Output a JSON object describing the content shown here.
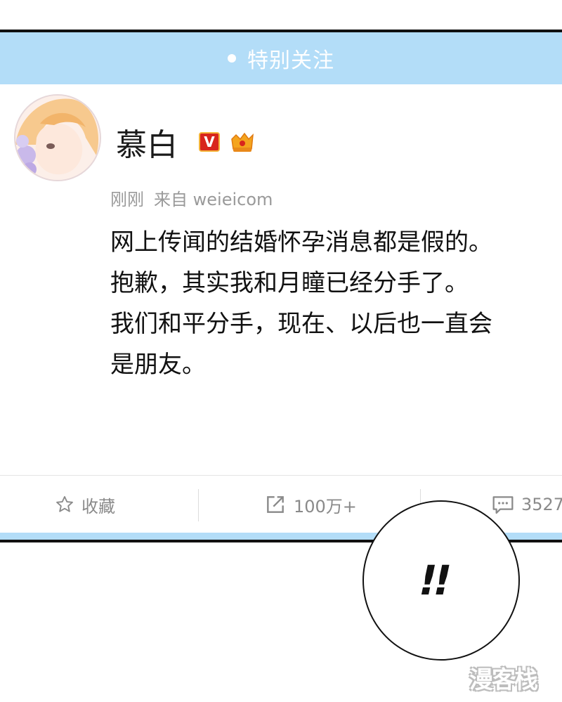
{
  "header": {
    "title": "特别关注"
  },
  "user": {
    "name": "慕白",
    "verified_badge": "V"
  },
  "post": {
    "time": "刚刚",
    "source_prefix": "来自",
    "source": "weieicom",
    "lines": [
      "网上传闻的结婚怀孕消息都是假的。",
      "抱歉，其实我和月瞳已经分手了。",
      "我们和平分手，现在、以后也一直会",
      "是朋友。"
    ]
  },
  "actions": {
    "favorite_label": "收藏",
    "repost_count": "100万+",
    "comment_count": "3527"
  },
  "bubble": {
    "text": "!!"
  },
  "watermark": {
    "text": "漫客栈"
  },
  "colors": {
    "header_bg": "#b3ddf8",
    "badge_red": "#d8251d",
    "badge_gold": "#f4b43a"
  },
  "icons": {
    "favorite": "star-icon",
    "repost": "share-icon",
    "comment": "comment-icon"
  }
}
